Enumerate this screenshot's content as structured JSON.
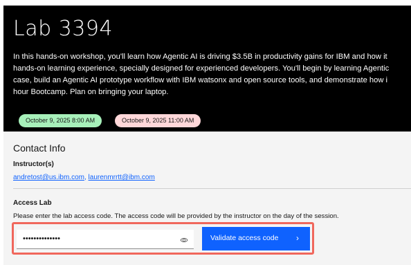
{
  "hero": {
    "title": "Lab 3394",
    "description_lines": [
      "In this hands-on workshop, you'll learn how Agentic AI is driving $3.5B in productivity gains for IBM and how it",
      "hands-on learning experience, specially designed for experienced developers. You'll begin by learning Agentic",
      "case, build an Agentic AI prototype workflow with IBM watsonx and open source tools, and demonstrate how i",
      "hour Bootcamp. Plan on bringing your laptop."
    ],
    "start_time": "October 9, 2025 8:00 AM",
    "end_time": "October 9, 2025 11:00 AM"
  },
  "contact": {
    "title": "Contact Info",
    "instructors_label": "Instructor(s)",
    "emails": [
      "andretost@us.ibm.com",
      "laurenmrrtt@ibm.com"
    ],
    "separator": ", "
  },
  "access": {
    "title": "Access Lab",
    "description": "Please enter the lab access code. The access code will be provided by the instructor on the day of the session.",
    "code_masked": "••••••••••••••",
    "validate_label": "Validate access code",
    "chevron": "›"
  },
  "colors": {
    "hero_bg": "#000000",
    "start_pill": "#a7f0ba",
    "end_pill": "#ffd7d9",
    "primary_button": "#0f62fe",
    "link": "#0f62fe",
    "highlight_border": "#f0675c",
    "panel_bg": "#f4f4f4"
  },
  "icons": {
    "show_password": "eye-icon",
    "button_arrow": "chevron-right-icon"
  }
}
